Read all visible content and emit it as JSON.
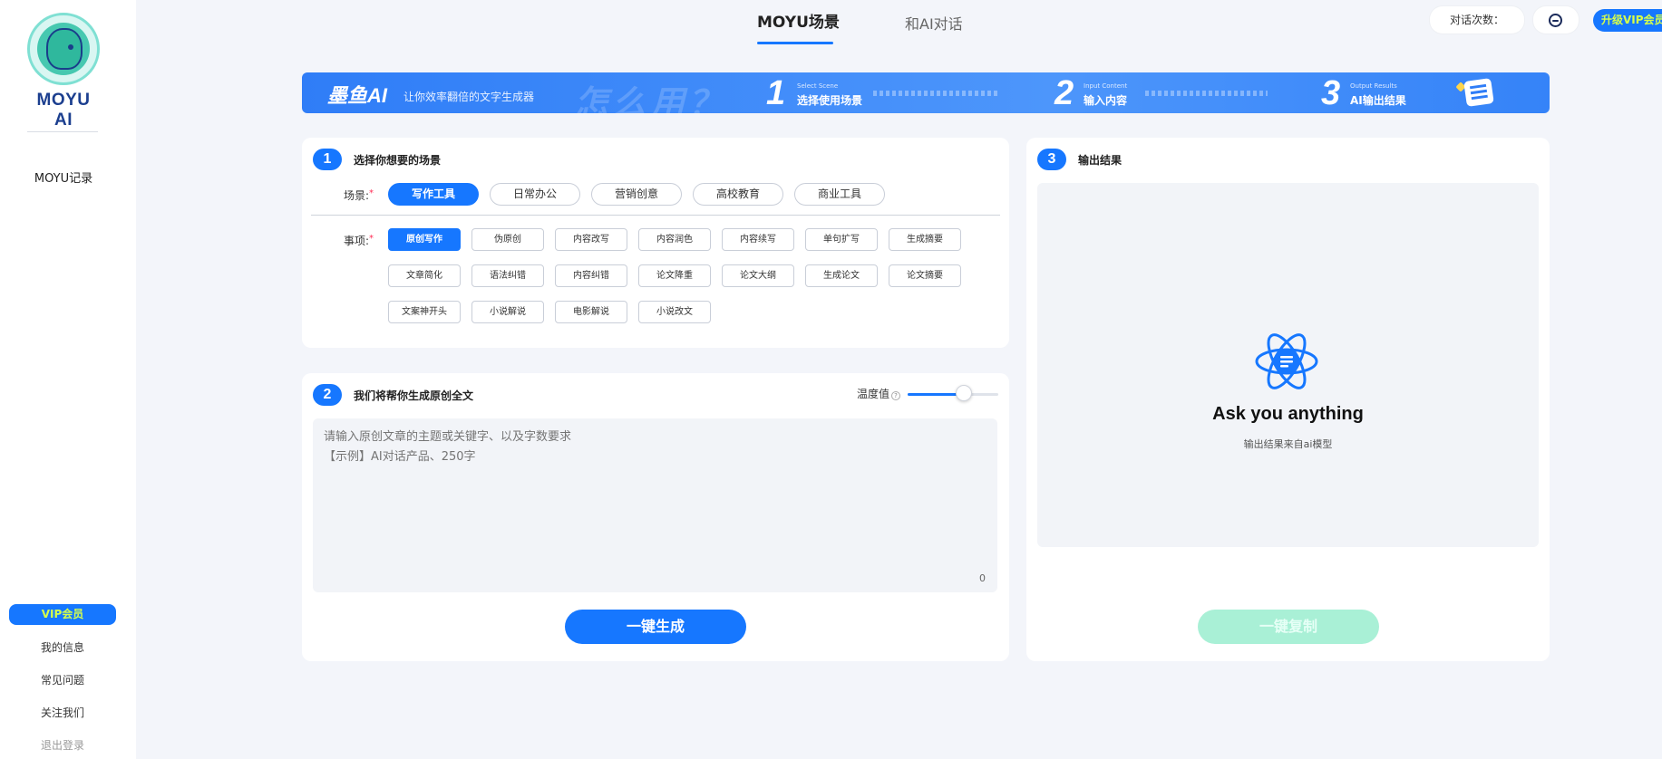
{
  "sidebar": {
    "logo_text": "MOYU AI",
    "record_link": "MOYU记录",
    "vip": "VIP会员",
    "links": [
      "我的信息",
      "常见问题",
      "关注我们"
    ],
    "logout": "退出登录"
  },
  "header": {
    "tabs": [
      "MOYU场景",
      "和AI对话"
    ],
    "active_tab": "MOYU场景",
    "count_label": "对话次数：",
    "upgrade": "升级VIP会员"
  },
  "banner": {
    "brand": "墨鱼AI",
    "slogan": "让你效率翻倍的文字生成器",
    "how": "怎么用？",
    "steps": [
      {
        "num": "1",
        "en": "Select Scene",
        "cn": "选择使用场景"
      },
      {
        "num": "2",
        "en": "Input Content",
        "cn": "输入内容"
      },
      {
        "num": "3",
        "en": "Output Results",
        "cn": "AI输出结果"
      }
    ]
  },
  "section1": {
    "num": "1",
    "title": "选择你想要的场景",
    "scene_label": "场景:",
    "scenes": [
      "写作工具",
      "日常办公",
      "营销创意",
      "高校教育",
      "商业工具"
    ],
    "active_scene": "写作工具",
    "item_label": "事项:",
    "items": [
      "原创写作",
      "伪原创",
      "内容改写",
      "内容润色",
      "内容续写",
      "单句扩写",
      "生成摘要",
      "文章简化",
      "语法纠错",
      "内容纠错",
      "论文降重",
      "论文大纲",
      "生成论文",
      "论文摘要",
      "文案神开头",
      "小说解说",
      "电影解说",
      "小说改文"
    ],
    "active_item": "原创写作"
  },
  "section2": {
    "num": "2",
    "title": "我们将帮你生成原创全文",
    "temperature_label": "温度值",
    "temperature_value": 0.62,
    "placeholder": "请输入原创文章的主题或关键字、以及字数要求\n【示例】AI对话产品、250字",
    "char_count": "0",
    "generate": "一键生成"
  },
  "section3": {
    "num": "3",
    "title": "输出结果",
    "headline": "Ask you anything",
    "subline": "输出结果来自ai模型",
    "copy": "一键复制"
  },
  "colors": {
    "primary": "#1677ff",
    "vip_text": "#d6ff4a",
    "copy_disabled": "#a9f0d6",
    "page_bg": "#f3f5fa"
  }
}
